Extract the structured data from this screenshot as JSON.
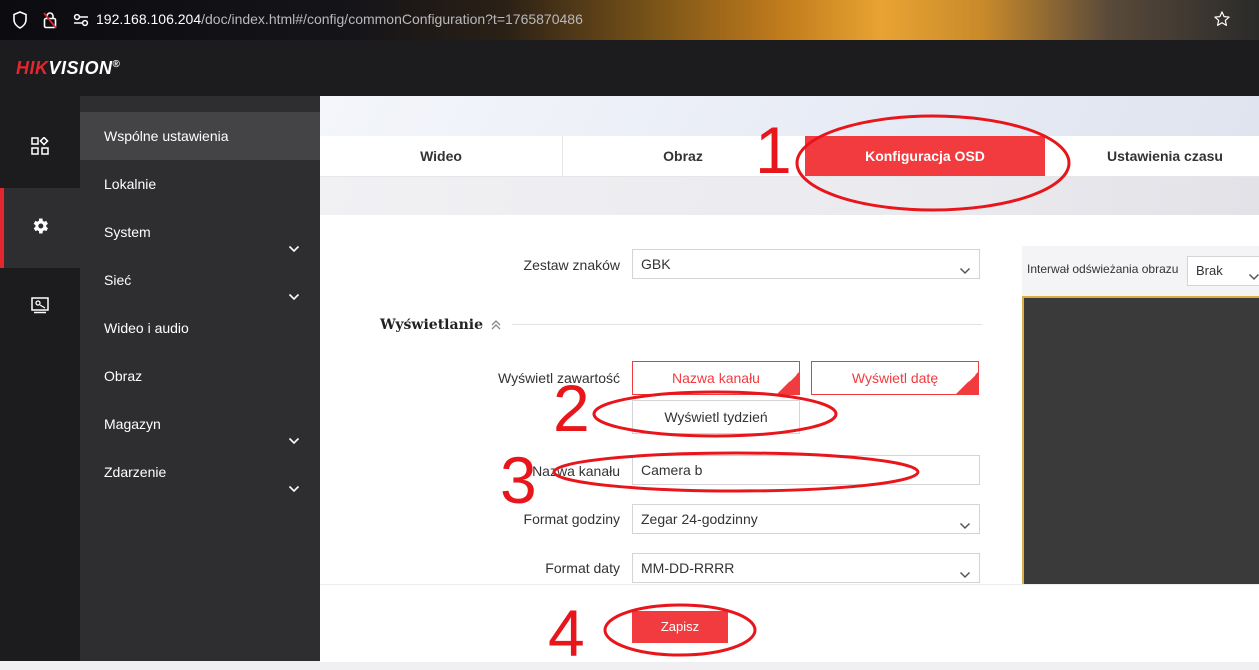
{
  "browser": {
    "url_host": "192.168.106.204",
    "url_path": "/doc/index.html#/config/commonConfiguration?t=1765870486"
  },
  "header": {
    "logo_main": "HIK",
    "logo_rest": "VISION",
    "logo_reg": "®"
  },
  "rail": {
    "items": [
      {
        "icon": "grid-apps-icon",
        "active": false
      },
      {
        "icon": "gear-icon",
        "active": true
      },
      {
        "icon": "monitor-icon",
        "active": false
      }
    ]
  },
  "sidebar": {
    "items": [
      {
        "label": "Wspólne ustawienia",
        "active": true,
        "expandable": false
      },
      {
        "label": "Lokalnie",
        "active": false,
        "expandable": false
      },
      {
        "label": "System",
        "active": false,
        "expandable": true
      },
      {
        "label": "Sieć",
        "active": false,
        "expandable": true
      },
      {
        "label": "Wideo i audio",
        "active": false,
        "expandable": false
      },
      {
        "label": "Obraz",
        "active": false,
        "expandable": false
      },
      {
        "label": "Magazyn",
        "active": false,
        "expandable": true
      },
      {
        "label": "Zdarzenie",
        "active": false,
        "expandable": true
      }
    ]
  },
  "tabs": [
    {
      "label": "Wideo",
      "active": false
    },
    {
      "label": "Obraz",
      "active": false
    },
    {
      "label": "Konfiguracja OSD",
      "active": true
    },
    {
      "label": "Ustawienia czasu",
      "active": false
    }
  ],
  "form": {
    "charset_label": "Zestaw znaków",
    "charset_value": "GBK",
    "section_title": "Wyświetlanie",
    "display_content_label": "Wyświetl zawartość",
    "display_options": [
      {
        "label": "Nazwa kanału",
        "checked": true
      },
      {
        "label": "Wyświetl datę",
        "checked": true
      },
      {
        "label": "Wyświetl tydzień",
        "checked": false
      }
    ],
    "channel_name_label": "Nazwa kanału",
    "channel_name_value": "Camera b",
    "hour_format_label": "Format godziny",
    "hour_format_value": "Zegar 24-godzinny",
    "date_format_label": "Format daty",
    "date_format_value": "MM-DD-RRRR"
  },
  "preview": {
    "refresh_label": "Interwał odświeżania obrazu",
    "refresh_value": "Brak"
  },
  "footer": {
    "save_label": "Zapisz"
  },
  "annotations": {
    "color": "#e8151b",
    "numbers": [
      "1",
      "2",
      "3",
      "4"
    ]
  },
  "colors": {
    "accent": "#f23b3f",
    "header_bg": "#1c1c1e",
    "sidebar_bg": "#2e2e30"
  }
}
